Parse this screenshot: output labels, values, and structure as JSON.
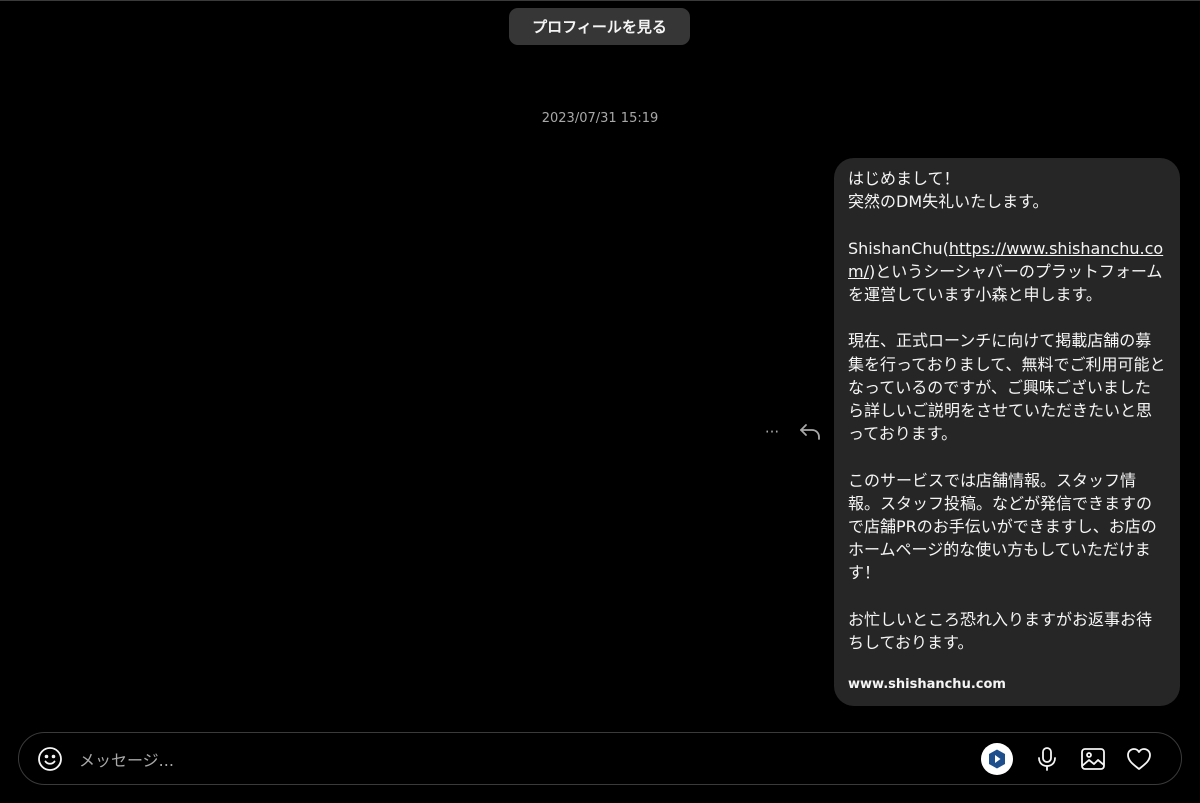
{
  "header": {
    "view_profile_label": "プロフィールを見る"
  },
  "thread": {
    "timestamp": "2023/07/31 15:19",
    "message": {
      "intro": "はじめまして！\n突然のDM失礼いたします。\n\nShishanChu(",
      "link_text": "https://www.shishanchu.com/",
      "body": ")というシーシャバーのプラットフォームを運営しています小森と申します。\n\n現在、正式ローンチに向けて掲載店舗の募集を行っておりまして、無料でご利用可能となっているのですが、ご興味ございましたら詳しいご説明をさせていただきたいと思っております。\n\nこのサービスでは店舗情報。スタッフ情報。スタッフ投稿。などが発信できますので店舗PRのお手伝いができますし、お店のホームページ的な使い方もしていただけます！\n\nお忙しいところ恐れ入りますがお返事お待ちしております。",
      "link_preview": "www.shishanchu.com"
    },
    "actions": {
      "more_icon": "more-icon",
      "reply_icon": "reply-icon",
      "more_glyph": "···"
    }
  },
  "composer": {
    "placeholder": "メッセージ...",
    "icons": [
      "emoji-icon",
      "extension-icon",
      "microphone-icon",
      "image-icon",
      "heart-icon"
    ]
  },
  "colors": {
    "background": "#000000",
    "bubble": "#262626",
    "button": "#363636",
    "text": "#f5f5f5",
    "muted": "#a8a8a8",
    "extension_accent": "#1f4e8c"
  }
}
